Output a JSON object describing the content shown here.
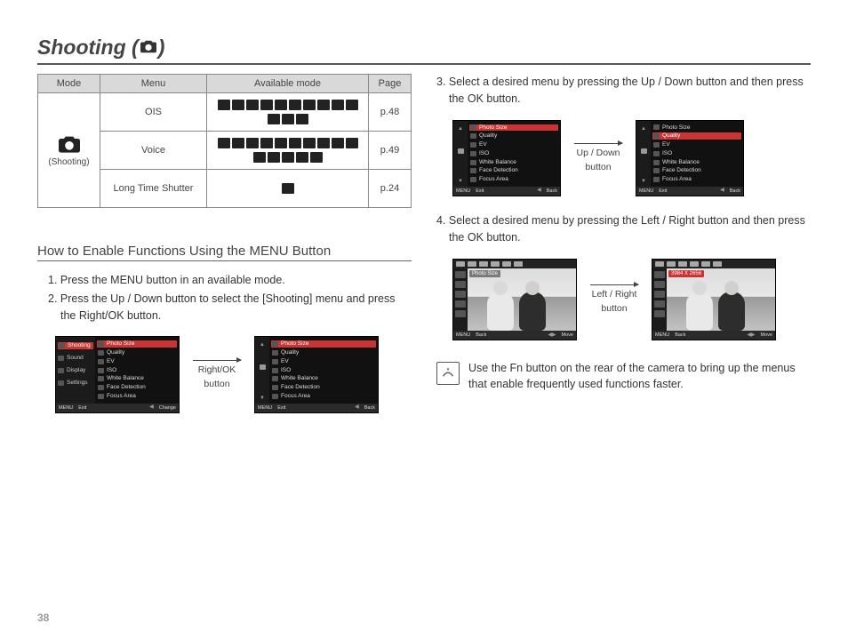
{
  "title_pre": "Shooting ( ",
  "title_post": " )",
  "table": {
    "headers": {
      "mode": "Mode",
      "menu": "Menu",
      "available": "Available mode",
      "page": "Page"
    },
    "mode_label": "(Shooting)",
    "rows": [
      {
        "menu": "OIS",
        "page": "p.48",
        "modes_count": 13
      },
      {
        "menu": "Voice",
        "page": "p.49",
        "modes_count": 15
      },
      {
        "menu": "Long Time Shutter",
        "page": "p.24",
        "modes_count": 1
      }
    ]
  },
  "subheading": "How to Enable Functions Using the MENU Button",
  "left_steps": {
    "s1": "1. Press the MENU button in an available mode.",
    "s2": "2. Press the Up / Down button to select the [Shooting] menu and press the Right/OK button."
  },
  "left_arrow_label_1": "Right/OK",
  "left_arrow_label_2": "button",
  "right_step3": "3. Select a desired menu by pressing the Up / Down button and then press the OK button.",
  "right_step4": "4. Select a desired menu by pressing the Left / Right button and then press the OK button.",
  "arrow3_l1": "Up / Down",
  "arrow3_l2": "button",
  "arrow4_l1": "Left / Right",
  "arrow4_l2": "button",
  "note": "Use the Fn button on the rear of the camera to bring up the menus that enable frequently used functions faster.",
  "lcd_left_menu": {
    "items": [
      "Shooting",
      "Sound",
      "Display",
      "Settings"
    ],
    "selected_index": 0
  },
  "lcd_right_menu": {
    "items": [
      "Photo Size",
      "Quality",
      "EV",
      "ISO",
      "White Balance",
      "Face Detection",
      "Focus Area"
    ]
  },
  "lcd_footer": {
    "exit": "Exit",
    "change": "Change",
    "back": "Back",
    "move": "Move",
    "menu": "MENU"
  },
  "lcd_step3_sel_a": "Photo Size",
  "lcd_step3_sel_b": "Quality",
  "lcd_step4_label_a": "Photo Size",
  "lcd_step4_label_b": "3984 X 2656",
  "page_number": "38"
}
